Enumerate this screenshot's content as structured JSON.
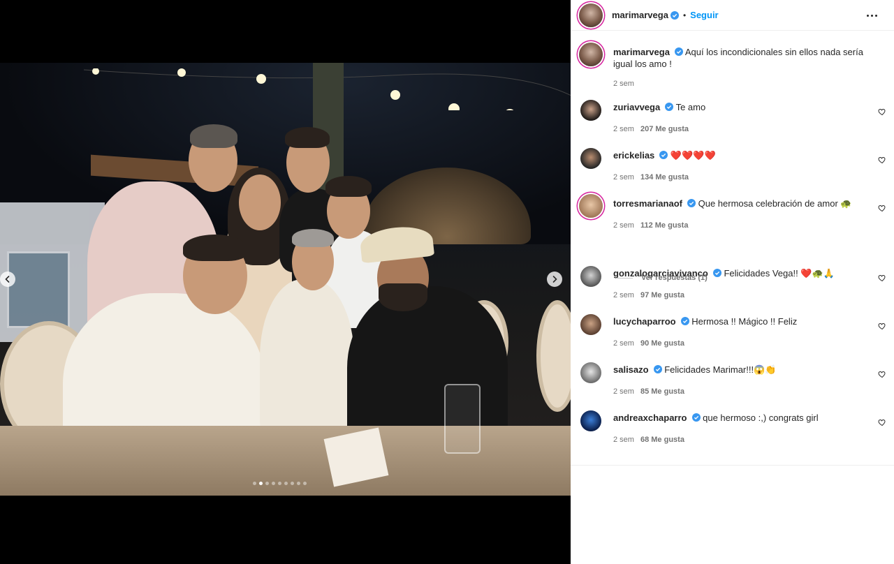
{
  "post": {
    "username": "marimarvega",
    "separator": "•",
    "follow_label": "Seguir",
    "caption": "Aquí los incondicionales sin ellos nada sería igual los amo !",
    "caption_time": "2 sem"
  },
  "carousel": {
    "total": 9,
    "active_index": 1
  },
  "comments": [
    {
      "username": "zuriavvega",
      "text": "Te amo",
      "time": "2 sem",
      "likes": "207 Me gusta"
    },
    {
      "username": "erickelias",
      "text": "❤️❤️❤️❤️",
      "time": "2 sem",
      "likes": "134 Me gusta"
    },
    {
      "username": "torresmarianaof",
      "text": "Que hermosa celebración de amor 🐢",
      "time": "2 sem",
      "likes": "112 Me gusta",
      "view_replies": "Ver respuestas (1)"
    },
    {
      "username": "gonzalogarciavivanco",
      "text": "Felicidades Vega!! ❤️🐢🙏",
      "time": "2 sem",
      "likes": "97 Me gusta"
    },
    {
      "username": "lucychaparroo",
      "text": "Hermosa !! Mágico !! Feliz",
      "time": "2 sem",
      "likes": "90 Me gusta"
    },
    {
      "username": "salisazo",
      "text": "Felicidades Marimar!!!😱👏",
      "time": "2 sem",
      "likes": "85 Me gusta"
    },
    {
      "username": "andreaxchaparro",
      "text": "que hermoso :,) congrats girl",
      "time": "2 sem",
      "likes": "68 Me gusta"
    }
  ],
  "colors": {
    "accent": "#0095f6",
    "verified": "#3897f0",
    "muted_text": "#737373",
    "heart_red": "#e0202f"
  },
  "icons": {
    "verified": "verified-badge-icon",
    "like": "heart-outline-icon",
    "more": "more-horizontal-icon",
    "prev": "chevron-left-icon",
    "next": "chevron-right-icon"
  }
}
